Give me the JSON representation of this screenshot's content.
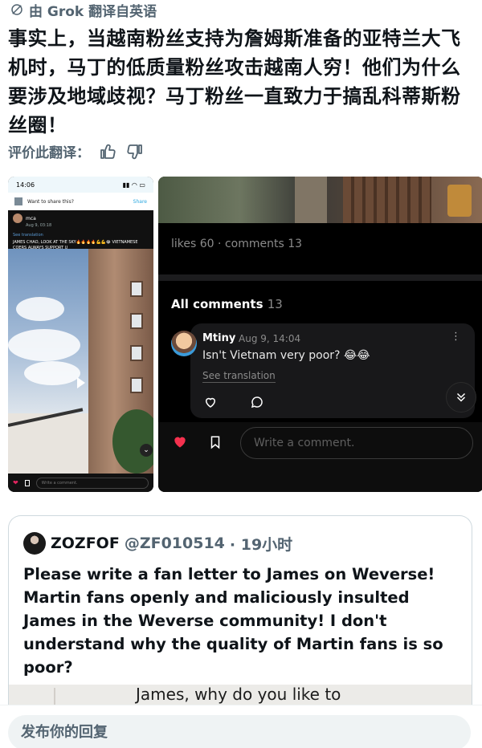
{
  "translation": {
    "label": "由 Grok 翻译自英语",
    "text": "事实上，当越南粉丝支持为詹姆斯准备的亚特兰大飞机时，马丁的低质量粉丝攻击越南人穷！他们为什么要涉及地域歧视？马丁粉丝一直致力于搞乱科蒂斯粉丝圈！",
    "rate_label": "评价此翻译："
  },
  "left_media": {
    "time": "14:06",
    "share_prompt": "Want to share this?",
    "share_button": "Share",
    "username": "mca",
    "date": "Aug 9, 03:18",
    "see_translation": "See translation",
    "post_text": "JAMES CHAO, LOOK AT THE SKY🔥🔥🔥🔥💪💪😂 VIETNAMESE COERS ALWAYS SUPPORT U",
    "comment_placeholder": "Write a comment."
  },
  "right_media": {
    "likes_label": "likes",
    "likes": "60",
    "comments_label": "comments",
    "comments": "13",
    "all_comments_label": "All comments",
    "all_comments_count": "13",
    "comment": {
      "author": "Mtiny",
      "date": "Aug 9, 14:04",
      "text": "Isn't Vietnam very poor? 😂😂",
      "see_translation": "See translation"
    },
    "comment_placeholder": "Write a comment."
  },
  "quote": {
    "name": "ZOZFOF",
    "handle": "@ZF010514",
    "time": "· 19小时",
    "text": "Please write a fan letter to James on Weverse! Martin fans openly and maliciously insulted James in the Weverse community! I don't understand why the quality of Martin fans is so poor?",
    "image_caption": "James, why do you like to"
  },
  "reply": {
    "placeholder": "发布你的回复"
  }
}
